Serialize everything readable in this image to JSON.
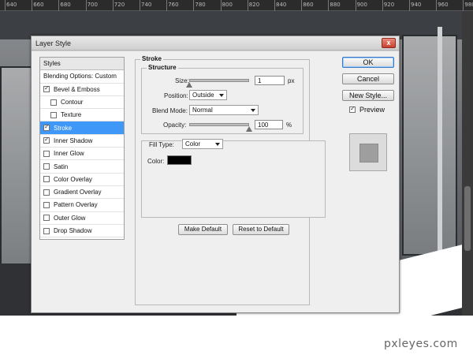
{
  "ruler": {
    "labels": [
      "640",
      "660",
      "680",
      "700",
      "720",
      "740",
      "760",
      "780",
      "800",
      "820",
      "840",
      "860",
      "880",
      "900",
      "920",
      "940",
      "960",
      "980"
    ]
  },
  "dialog": {
    "title": "Layer Style",
    "close_glyph": "x",
    "styles_header": "Styles",
    "blending_label": "Blending Options: Custom",
    "styles": [
      {
        "label": "Bevel & Emboss",
        "checked": true,
        "indent": false,
        "selected": false
      },
      {
        "label": "Contour",
        "checked": false,
        "indent": true,
        "selected": false
      },
      {
        "label": "Texture",
        "checked": false,
        "indent": true,
        "selected": false
      },
      {
        "label": "Stroke",
        "checked": true,
        "indent": false,
        "selected": true
      },
      {
        "label": "Inner Shadow",
        "checked": true,
        "indent": false,
        "selected": false
      },
      {
        "label": "Inner Glow",
        "checked": false,
        "indent": false,
        "selected": false
      },
      {
        "label": "Satin",
        "checked": false,
        "indent": false,
        "selected": false
      },
      {
        "label": "Color Overlay",
        "checked": false,
        "indent": false,
        "selected": false
      },
      {
        "label": "Gradient Overlay",
        "checked": false,
        "indent": false,
        "selected": false
      },
      {
        "label": "Pattern Overlay",
        "checked": false,
        "indent": false,
        "selected": false
      },
      {
        "label": "Outer Glow",
        "checked": false,
        "indent": false,
        "selected": false
      },
      {
        "label": "Drop Shadow",
        "checked": false,
        "indent": false,
        "selected": false
      }
    ],
    "stroke": {
      "title": "Stroke",
      "structure_title": "Structure",
      "size_label": "Size:",
      "size_value": "1",
      "size_unit": "px",
      "position_label": "Position:",
      "position_value": "Outside",
      "blend_label": "Blend Mode:",
      "blend_value": "Normal",
      "opacity_label": "Opacity:",
      "opacity_value": "100",
      "opacity_unit": "%",
      "size_fraction": 0.0,
      "opacity_fraction": 1.0,
      "fill_type_label": "Fill Type:",
      "fill_type_value": "Color",
      "color_label": "Color:",
      "color_value": "#000000"
    },
    "buttons": {
      "make_default": "Make Default",
      "reset_default": "Reset to Default",
      "ok": "OK",
      "cancel": "Cancel",
      "new_style": "New Style...",
      "preview_label": "Preview",
      "preview_checked": true
    }
  },
  "watermark": "pxleyes.com",
  "colors": {
    "selection": "#3f97f7",
    "dialog_bg": "#efefef",
    "stroke_color": "#000000"
  }
}
